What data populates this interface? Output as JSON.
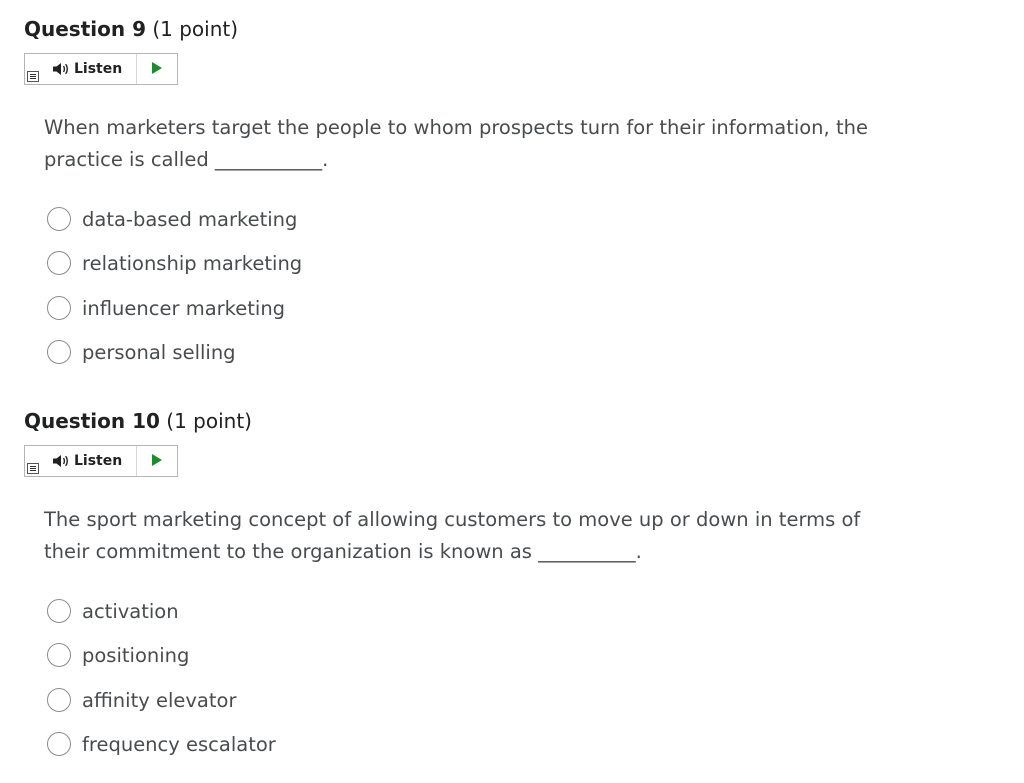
{
  "questions": [
    {
      "number": "Question 9",
      "points": "(1 point)",
      "listen_label": "Listen",
      "text": "When marketers target the people to whom prospects turn for their information, the practice is called ___________.",
      "choices": [
        {
          "label": "data-based marketing"
        },
        {
          "label": "relationship marketing"
        },
        {
          "label": "influencer marketing"
        },
        {
          "label": "personal selling"
        }
      ]
    },
    {
      "number": "Question 10",
      "points": "(1 point)",
      "listen_label": "Listen",
      "text": "The sport marketing concept of allowing customers to move up or down in terms of their commitment to the organization is known as __________.",
      "choices": [
        {
          "label": "activation"
        },
        {
          "label": "positioning"
        },
        {
          "label": "affinity elevator"
        },
        {
          "label": "frequency escalator"
        }
      ]
    }
  ],
  "icons": {
    "speaker": "speaker-icon",
    "play": "play-icon",
    "menu": "menu-icon"
  },
  "colors": {
    "play": "#1e8a2e",
    "text": "#494c4e",
    "heading": "#202122"
  }
}
